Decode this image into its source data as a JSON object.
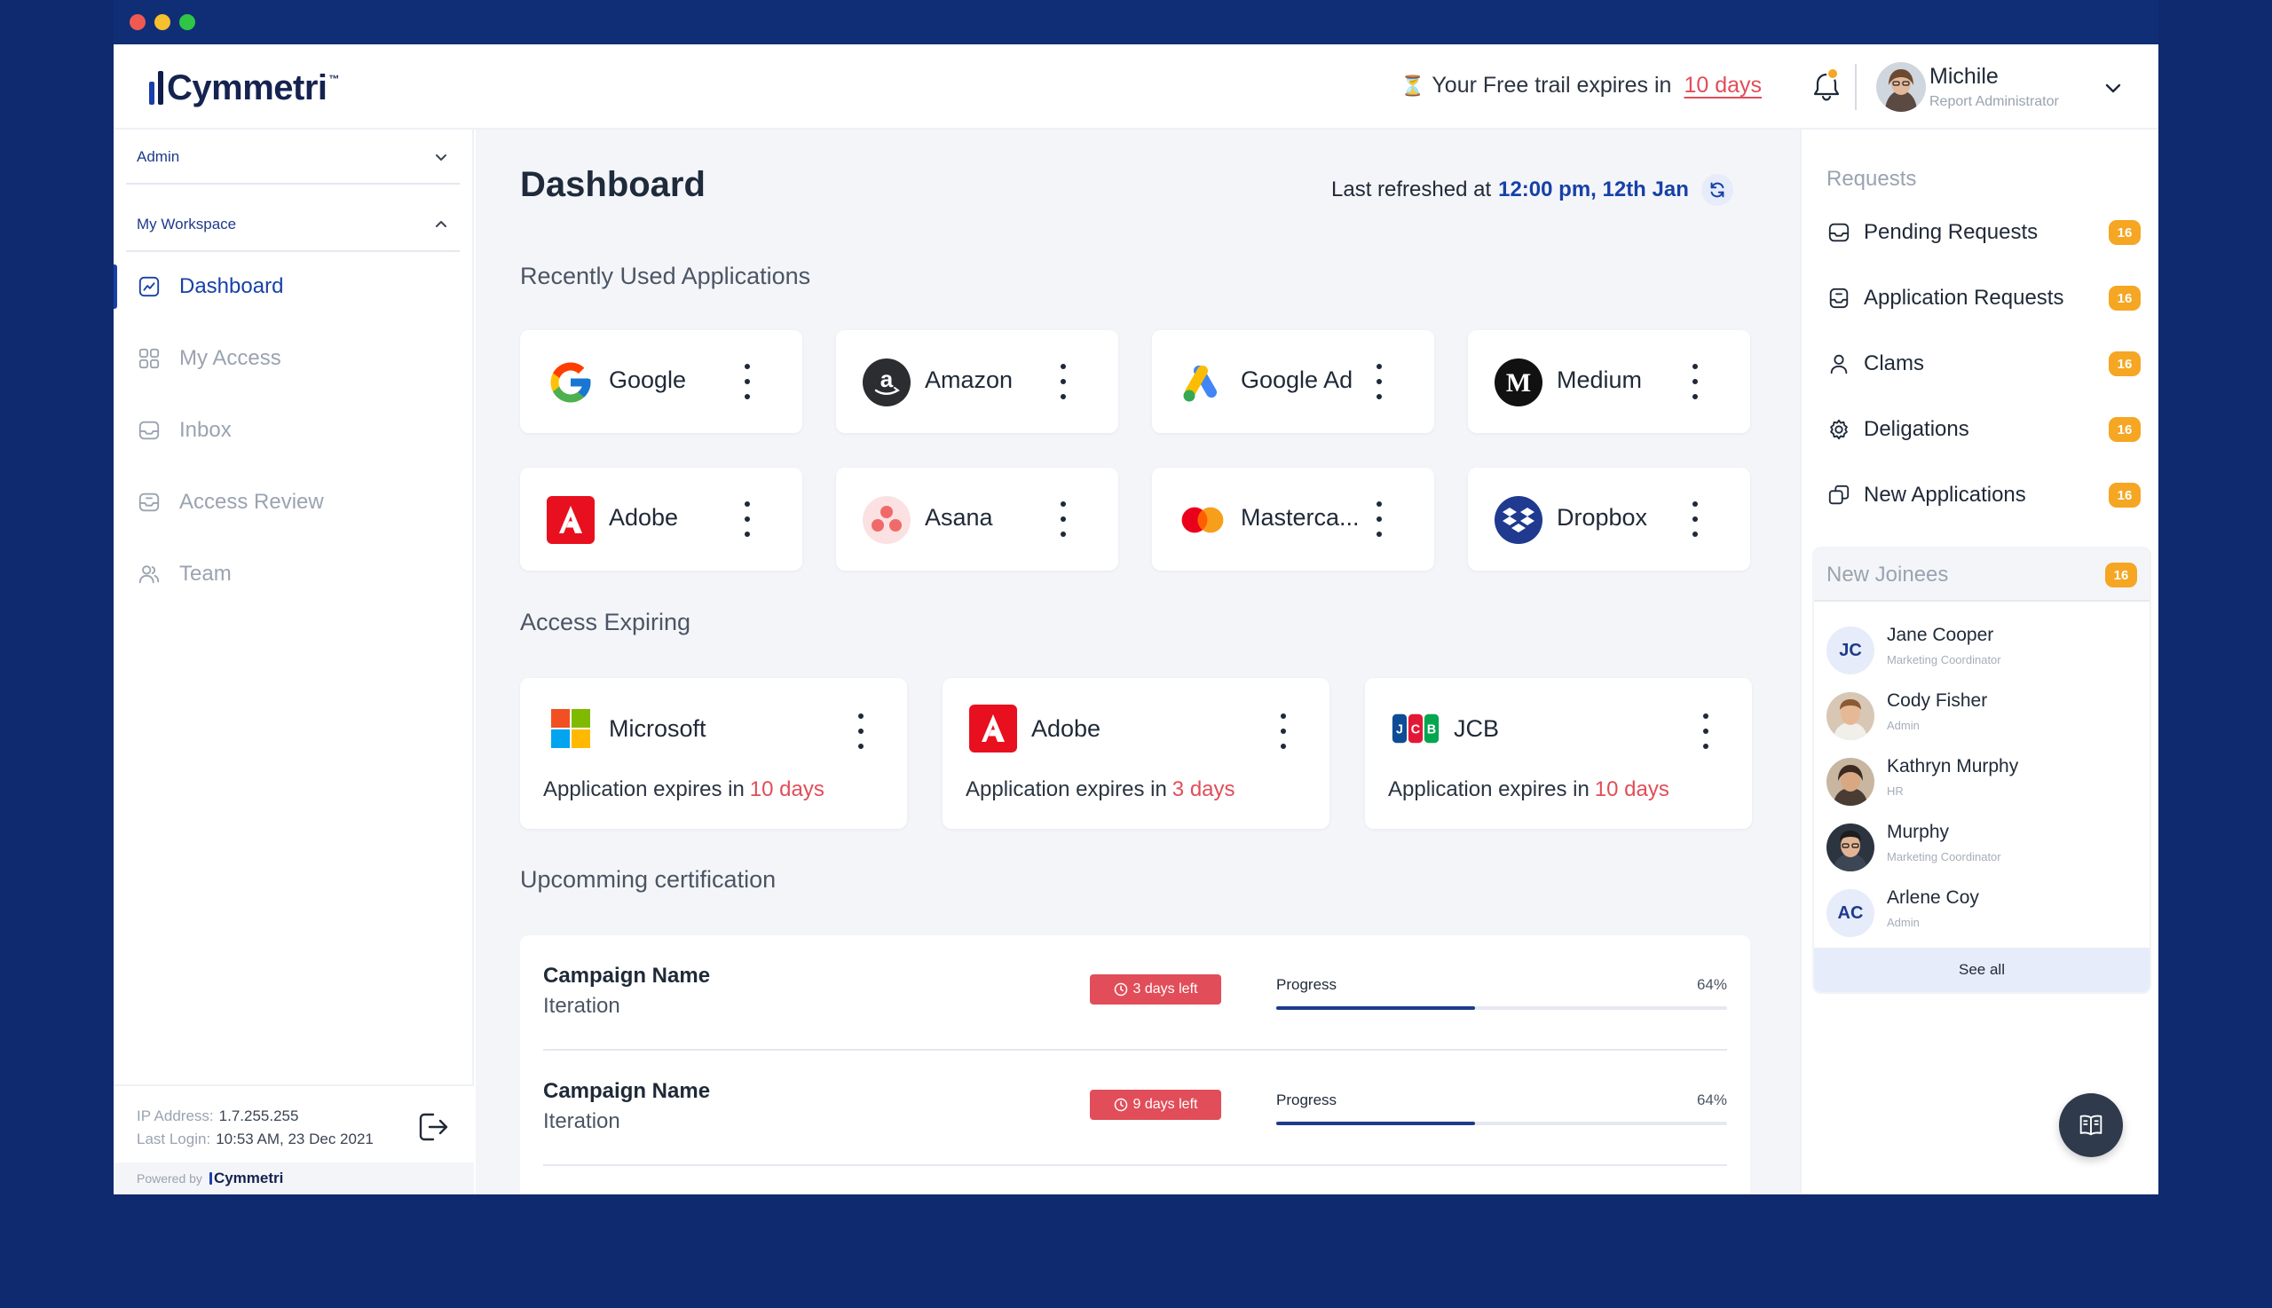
{
  "header": {
    "logo_text": "Cymmetri",
    "logo_tm": "™",
    "trial_prefix": "Your Free trail expires in",
    "trial_days": "10 days",
    "user": {
      "name": "Michile",
      "role": "Report Administrator"
    }
  },
  "sidebar": {
    "admin_label": "Admin",
    "workspace_label": "My Workspace",
    "items": [
      {
        "label": "Dashboard",
        "icon": "chart-icon",
        "active": true
      },
      {
        "label": "My Access",
        "icon": "grid-icon",
        "active": false
      },
      {
        "label": "Inbox",
        "icon": "inbox-icon",
        "active": false
      },
      {
        "label": "Access Review",
        "icon": "review-icon",
        "active": false
      },
      {
        "label": "Team",
        "icon": "team-icon",
        "active": false
      }
    ],
    "ip_label": "IP Address:",
    "ip_value": "1.7.255.255",
    "login_label": "Last Login:",
    "login_value": "10:53 AM, 23 Dec 2021",
    "powered_by": "Powered by",
    "powered_logo": "Cymmetri"
  },
  "main": {
    "title": "Dashboard",
    "refreshed_label": "Last refreshed at",
    "refreshed_time": "12:00 pm, 12th Jan",
    "recent_title": "Recently Used Applications",
    "recent_apps": [
      {
        "name": "Google",
        "icon": "google-icon"
      },
      {
        "name": "Amazon",
        "icon": "amazon-icon"
      },
      {
        "name": "Google Ad",
        "icon": "google-ads-icon"
      },
      {
        "name": "Medium",
        "icon": "medium-icon"
      },
      {
        "name": "Adobe",
        "icon": "adobe-icon"
      },
      {
        "name": "Asana",
        "icon": "asana-icon"
      },
      {
        "name": "Masterca...",
        "icon": "mastercard-icon"
      },
      {
        "name": "Dropbox",
        "icon": "dropbox-icon"
      }
    ],
    "expiring_title": "Access Expiring",
    "expiring": [
      {
        "name": "Microsoft",
        "text": "Application expires in",
        "days": "10 days",
        "icon": "microsoft-icon"
      },
      {
        "name": "Adobe",
        "text": "Application expires in",
        "days": "3 days",
        "icon": "adobe-icon"
      },
      {
        "name": "JCB",
        "text": "Application expires in",
        "days": "10 days",
        "icon": "jcb-icon"
      }
    ],
    "cert_title": "Upcomming certification",
    "certifications": [
      {
        "name": "Campaign Name",
        "iteration": "Iteration",
        "badge": "3 days left",
        "progress_label": "Progress",
        "progress_pct": "64%",
        "progress": 0.44
      },
      {
        "name": "Campaign Name",
        "iteration": "Iteration",
        "badge": "9 days left",
        "progress_label": "Progress",
        "progress_pct": "64%",
        "progress": 0.44
      }
    ]
  },
  "right": {
    "requests_title": "Requests",
    "requests": [
      {
        "label": "Pending Requests",
        "count": "16",
        "icon": "pending-icon"
      },
      {
        "label": "Application Requests",
        "count": "16",
        "icon": "application-icon"
      },
      {
        "label": "Clams",
        "count": "16",
        "icon": "person-icon"
      },
      {
        "label": "Deligations",
        "count": "16",
        "icon": "gear-icon"
      },
      {
        "label": "New Applications",
        "count": "16",
        "icon": "new-app-icon"
      }
    ],
    "joinees_title": "New Joinees",
    "joinees_count": "16",
    "joinees": [
      {
        "name": "Jane Cooper",
        "role": "Marketing Coordinator",
        "initials": "JC"
      },
      {
        "name": "Cody Fisher",
        "role": "Admin",
        "initials": ""
      },
      {
        "name": "Kathryn Murphy",
        "role": "HR",
        "initials": ""
      },
      {
        "name": "Murphy",
        "role": "Marketing Coordinator",
        "initials": ""
      },
      {
        "name": "Arlene Coy",
        "role": "Admin",
        "initials": "AC"
      }
    ],
    "see_all": "See all"
  },
  "colors": {
    "accent": "#1741a8",
    "danger": "#e14d58",
    "badge": "#f5a623",
    "frame": "#0f2a6e"
  }
}
